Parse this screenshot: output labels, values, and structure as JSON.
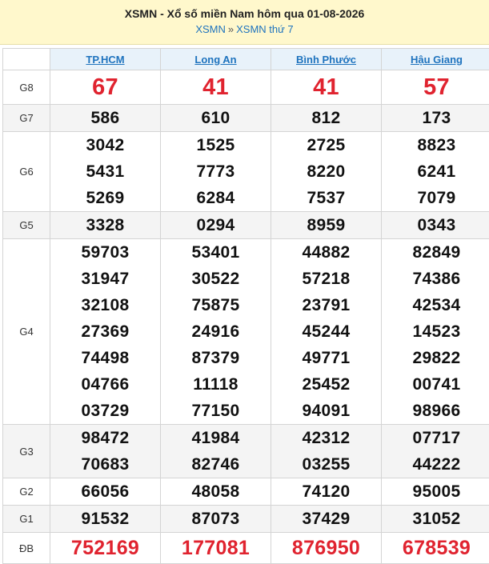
{
  "header": {
    "title": "XSMN - Xổ số miền Nam hôm qua 01-08-2026",
    "breadcrumb": [
      {
        "label": "XSMN"
      },
      {
        "label": "XSMN thứ 7"
      }
    ],
    "separator": "»"
  },
  "provinces": [
    "TP.HCM",
    "Long An",
    "Bình Phước",
    "Hậu Giang"
  ],
  "prizes": [
    {
      "label": "G8",
      "style": "red",
      "values": [
        [
          "67"
        ],
        [
          "41"
        ],
        [
          "41"
        ],
        [
          "57"
        ]
      ]
    },
    {
      "label": "G7",
      "style": "normal",
      "values": [
        [
          "586"
        ],
        [
          "610"
        ],
        [
          "812"
        ],
        [
          "173"
        ]
      ]
    },
    {
      "label": "G6",
      "style": "normal",
      "values": [
        [
          "3042",
          "5431",
          "5269"
        ],
        [
          "1525",
          "7773",
          "6284"
        ],
        [
          "2725",
          "8220",
          "7537"
        ],
        [
          "8823",
          "6241",
          "7079"
        ]
      ]
    },
    {
      "label": "G5",
      "style": "normal",
      "values": [
        [
          "3328"
        ],
        [
          "0294"
        ],
        [
          "8959"
        ],
        [
          "0343"
        ]
      ]
    },
    {
      "label": "G4",
      "style": "normal",
      "values": [
        [
          "59703",
          "31947",
          "32108",
          "27369",
          "74498",
          "04766",
          "03729"
        ],
        [
          "53401",
          "30522",
          "75875",
          "24916",
          "87379",
          "11118",
          "77150"
        ],
        [
          "44882",
          "57218",
          "23791",
          "45244",
          "49771",
          "25452",
          "94091"
        ],
        [
          "82849",
          "74386",
          "42534",
          "14523",
          "29822",
          "00741",
          "98966"
        ]
      ]
    },
    {
      "label": "G3",
      "style": "normal",
      "values": [
        [
          "98472",
          "70683"
        ],
        [
          "41984",
          "82746"
        ],
        [
          "42312",
          "03255"
        ],
        [
          "07717",
          "44222"
        ]
      ]
    },
    {
      "label": "G2",
      "style": "normal",
      "values": [
        [
          "66056"
        ],
        [
          "48058"
        ],
        [
          "74120"
        ],
        [
          "95005"
        ]
      ]
    },
    {
      "label": "G1",
      "style": "normal",
      "values": [
        [
          "91532"
        ],
        [
          "87073"
        ],
        [
          "37429"
        ],
        [
          "31052"
        ]
      ]
    },
    {
      "label": "ĐB",
      "style": "db",
      "values": [
        [
          "752169"
        ],
        [
          "177081"
        ],
        [
          "876950"
        ],
        [
          "678539"
        ]
      ]
    }
  ],
  "colors": {
    "header_bg": "#fff8cc",
    "link": "#1e73be",
    "red": "#e0232f",
    "province_bg": "#e8f2fa",
    "alt_row_bg": "#f4f4f4"
  }
}
